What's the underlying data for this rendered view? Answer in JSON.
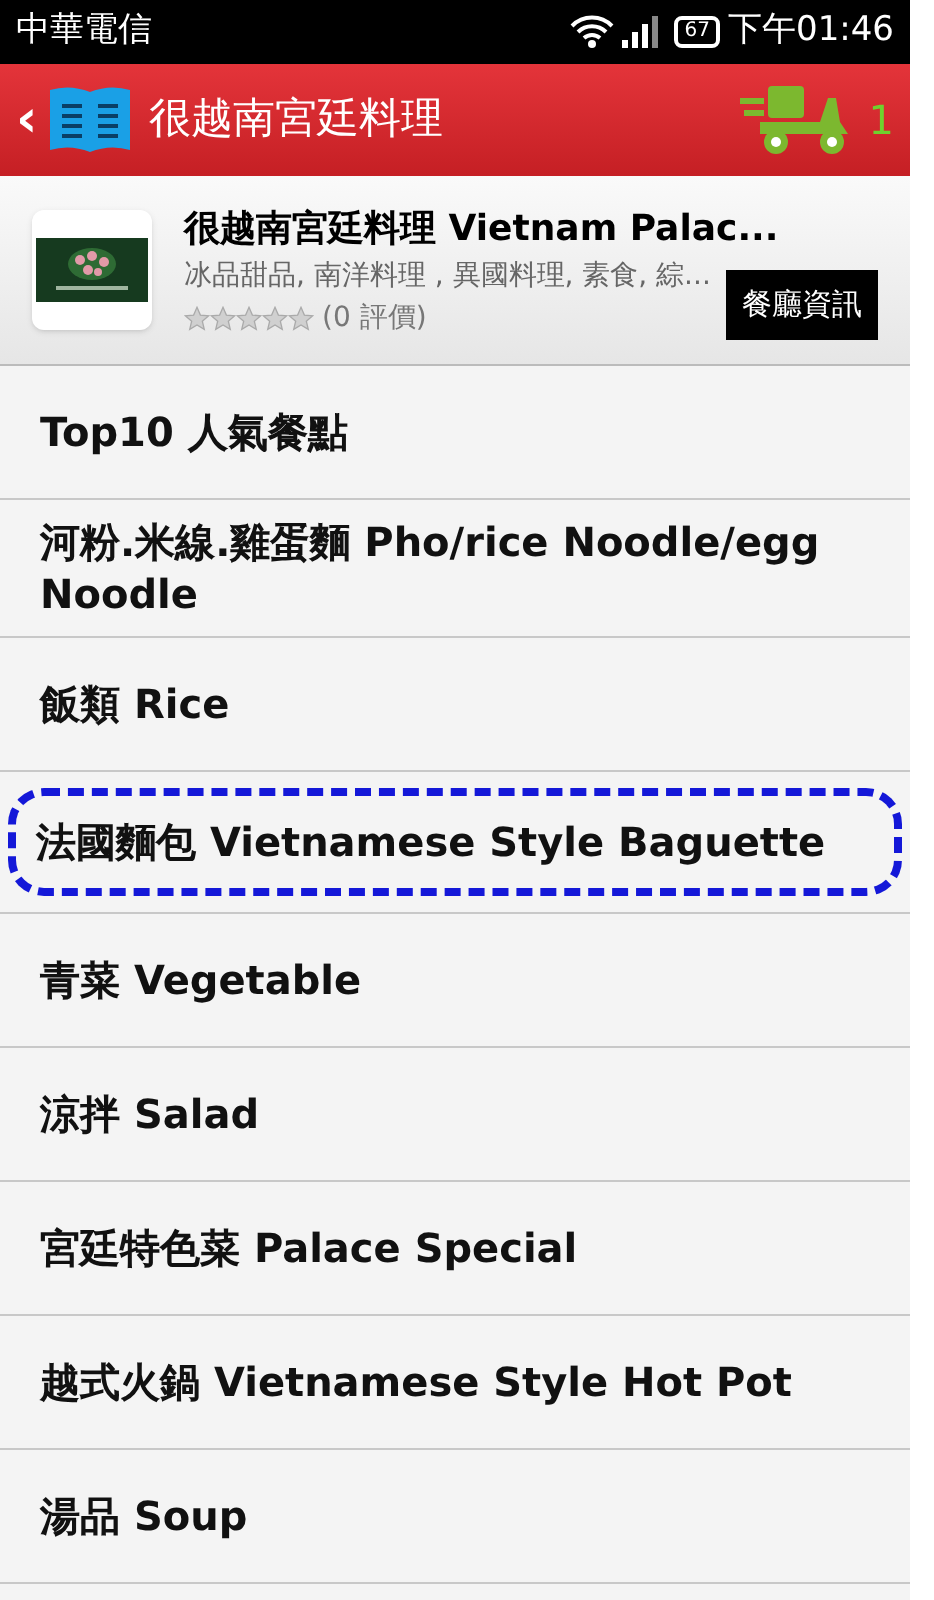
{
  "status_bar": {
    "carrier": "中華電信",
    "battery": "67",
    "time": "下午01:46"
  },
  "header": {
    "back": "‹",
    "title": "很越南宮廷料理",
    "cart_count": "1"
  },
  "restaurant": {
    "name": "很越南宮廷料理 Vietnam Palac...",
    "categories": "冰品甜品, 南洋料理 , 異國料理, 素食, 綜...",
    "stars": 0,
    "reviews": "(0 評價)",
    "info_button": "餐廳資訊"
  },
  "menu_categories": [
    {
      "label": "Top10 人氣餐點",
      "highlighted": false
    },
    {
      "label": "河粉.米線.雞蛋麵 Pho/rice Noodle/egg Noodle",
      "highlighted": false
    },
    {
      "label": "飯類 Rice",
      "highlighted": false
    },
    {
      "label": "法國麵包 Vietnamese Style Baguette",
      "highlighted": true
    },
    {
      "label": "青菜 Vegetable",
      "highlighted": false
    },
    {
      "label": "涼拌 Salad",
      "highlighted": false
    },
    {
      "label": "宮廷特色菜 Palace Special",
      "highlighted": false
    },
    {
      "label": "越式火鍋 Vietnamese Style Hot Pot",
      "highlighted": false
    },
    {
      "label": "湯品 Soup",
      "highlighted": false
    }
  ]
}
